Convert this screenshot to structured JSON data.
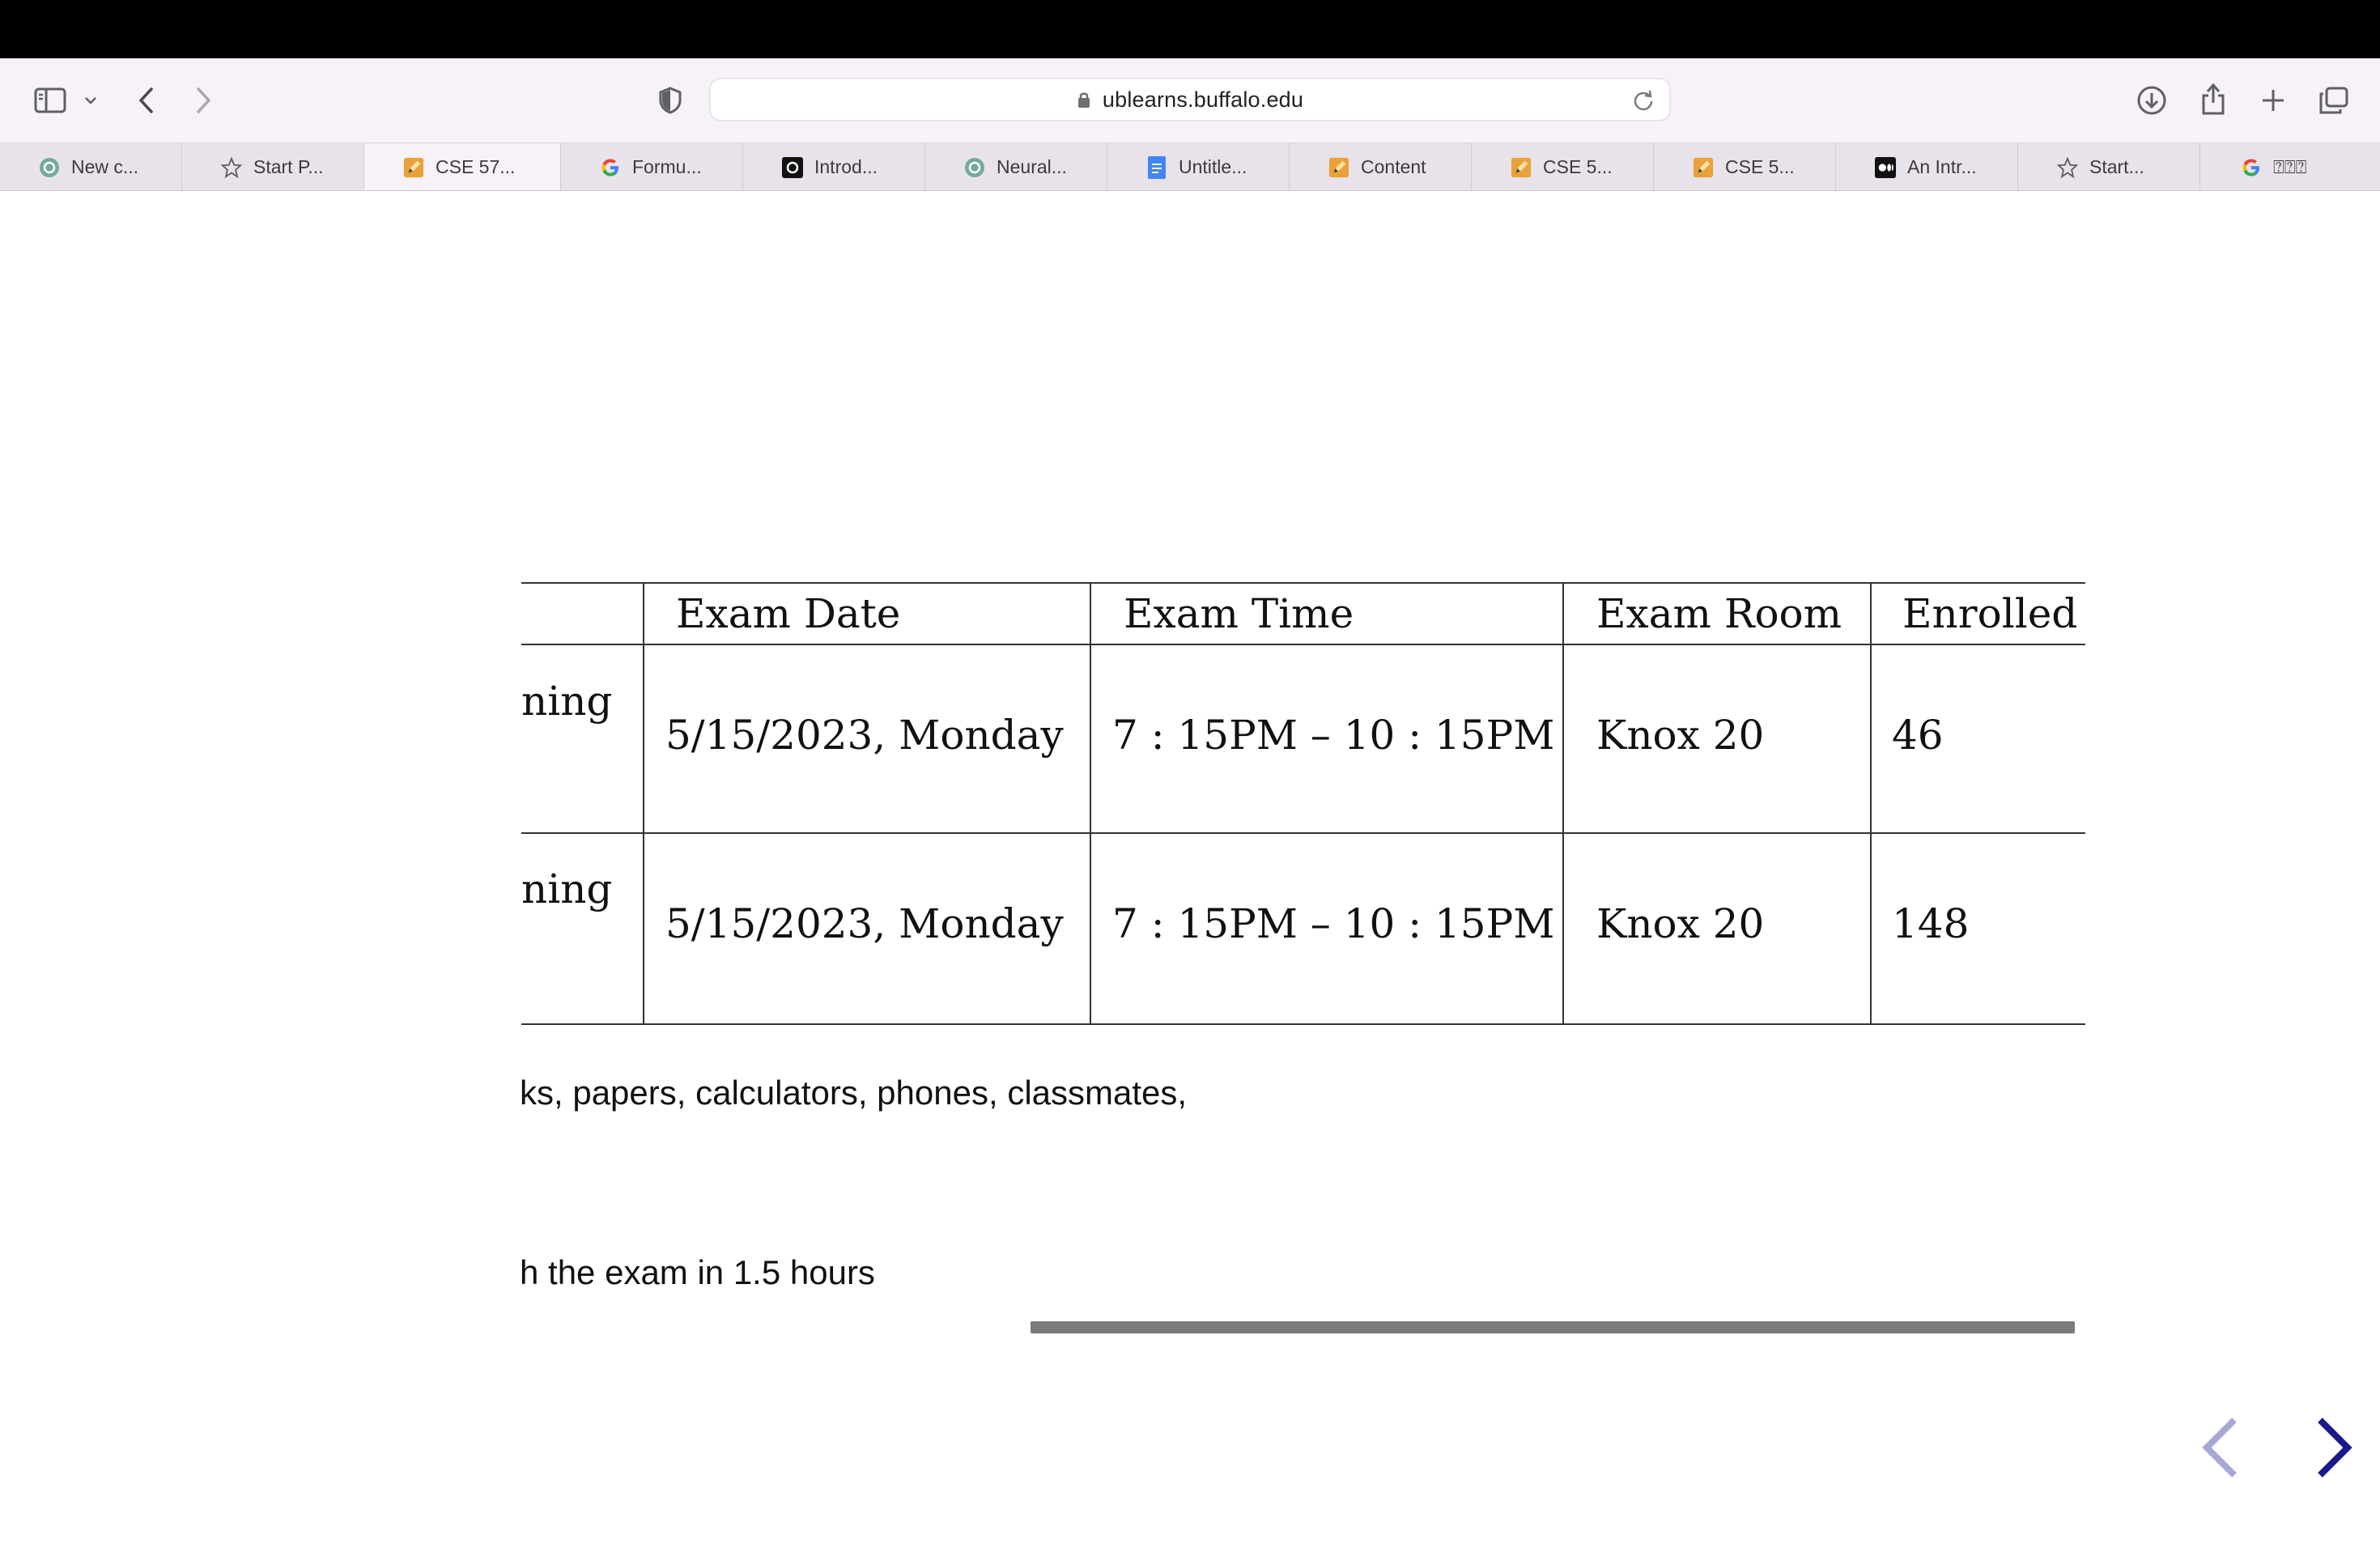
{
  "browser": {
    "url": "ublearns.buffalo.edu",
    "tabs": [
      {
        "label": "New c...",
        "icon": "openai-icon"
      },
      {
        "label": "Start P...",
        "icon": "star-icon"
      },
      {
        "label": "CSE 57...",
        "icon": "pencil-icon"
      },
      {
        "label": "Formu...",
        "icon": "google-icon"
      },
      {
        "label": "Introd...",
        "icon": "openai-icon"
      },
      {
        "label": "Neural...",
        "icon": "openai-icon"
      },
      {
        "label": "Untitle...",
        "icon": "docs-icon"
      },
      {
        "label": "Content",
        "icon": "pencil-icon"
      },
      {
        "label": "CSE 5...",
        "icon": "pencil-icon"
      },
      {
        "label": "CSE 5...",
        "icon": "pencil-icon"
      },
      {
        "label": "An Intr...",
        "icon": "medium-icon"
      },
      {
        "label": "Start...",
        "icon": "star-icon"
      },
      {
        "label": "⍰⍰⍰",
        "icon": "google-icon"
      }
    ],
    "active_tab": 2
  },
  "exam_table": {
    "headers": [
      "Exam Date",
      "Exam Time",
      "Exam Room",
      "Enrolled"
    ],
    "rows": [
      {
        "course": "ning",
        "date": "5/15/2023,  Monday",
        "time": "7 : 15PM – 10 : 15PM",
        "room": "Knox 20",
        "enrolled": "46"
      },
      {
        "course": "ning",
        "date": "5/15/2023,  Monday",
        "time": "7 : 15PM – 10 : 15PM",
        "room": "Knox 20",
        "enrolled": "148"
      }
    ]
  },
  "notes": {
    "line1": "ks, papers, calculators, phones, classmates,",
    "line2": "h the exam in 1.5 hours"
  },
  "colors": {
    "accent_nav": "#1a1a8c",
    "accent_nav_disabled": "#a7a7d6",
    "toolbar_bg": "#f6f2f7"
  }
}
